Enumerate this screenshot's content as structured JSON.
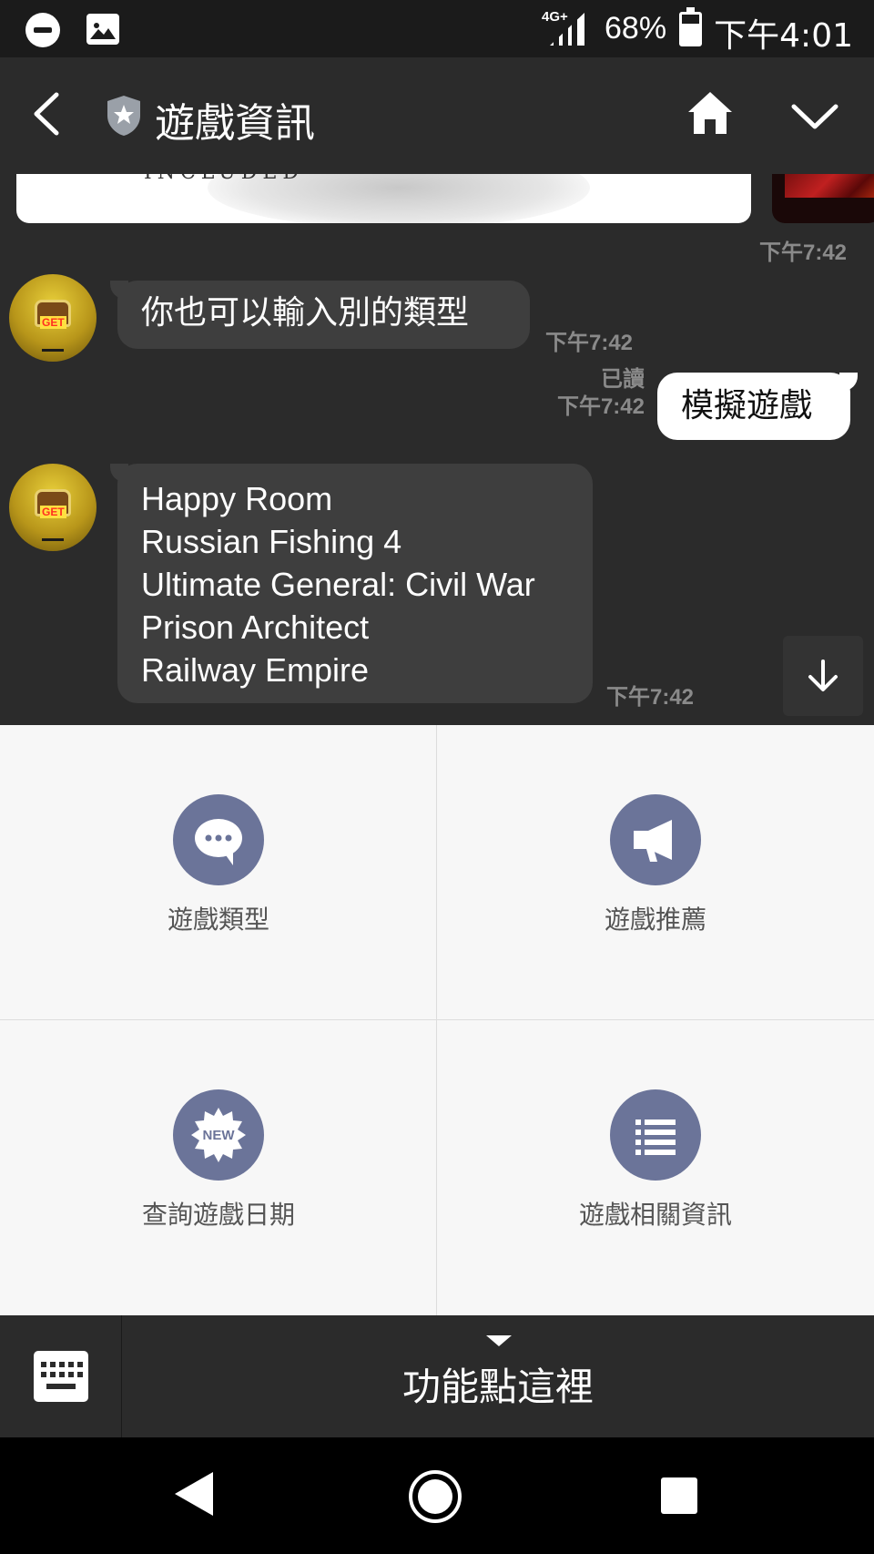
{
  "status_bar": {
    "network": "4G+",
    "battery_percent": "68%",
    "time": "下午4:01"
  },
  "header": {
    "title": "遊戲資訊"
  },
  "chat": {
    "image_caption": "INCLUDED",
    "image_timestamp": "下午7:42",
    "messages": [
      {
        "sender": "bot",
        "text": "你也可以輸入別的類型",
        "time": "下午7:42"
      },
      {
        "sender": "user",
        "text": "模擬遊戲",
        "read": "已讀",
        "time": "下午7:42"
      },
      {
        "sender": "bot",
        "lines": [
          "Happy Room",
          "Russian Fishing 4",
          "Ultimate General: Civil War",
          "Prison Architect",
          "Railway Empire"
        ],
        "time": "下午7:42"
      }
    ]
  },
  "rich_menu": {
    "items": [
      {
        "label": "遊戲類型",
        "icon": "chat-bubble-icon"
      },
      {
        "label": "遊戲推薦",
        "icon": "megaphone-icon"
      },
      {
        "label": "查詢遊戲日期",
        "icon": "new-badge-icon",
        "badge_text": "NEW"
      },
      {
        "label": "遊戲相關資訊",
        "icon": "list-icon"
      }
    ]
  },
  "bottom_bar": {
    "function_label": "功能點這裡"
  },
  "colors": {
    "chat_bg": "#2b2b2b",
    "incoming_bubble": "#3e3e3e",
    "outgoing_bubble": "#ffffff",
    "menu_icon_circle": "#6b7499",
    "menu_bg": "#f7f7f7"
  }
}
